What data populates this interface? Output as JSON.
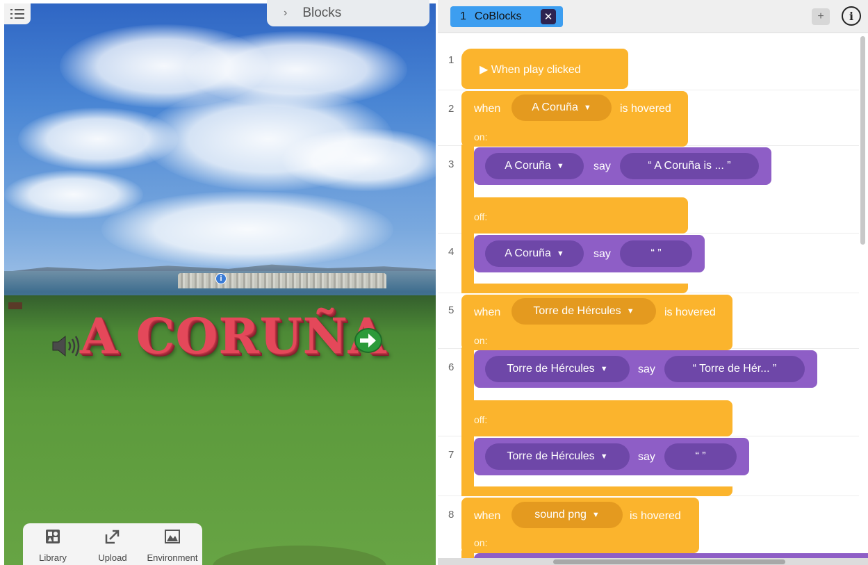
{
  "scene": {
    "blocks_tab_label": "Blocks",
    "title_3d": "A CORUÑA",
    "info_marker": "i",
    "toolbar": [
      {
        "label": "Library",
        "icon": "library-icon"
      },
      {
        "label": "Upload",
        "icon": "upload-icon"
      },
      {
        "label": "Environment",
        "icon": "environment-icon"
      }
    ]
  },
  "editor": {
    "tab": {
      "number": "1",
      "name": "CoBlocks",
      "close": "✕"
    },
    "add_label": "+",
    "info_label": "i",
    "line_numbers": [
      "1",
      "2",
      "3",
      "4",
      "5",
      "6",
      "7",
      "8"
    ],
    "blocks": {
      "play": "▶ When play clicked",
      "b2": {
        "when": "when",
        "object": "A Coruña",
        "event": "is hovered",
        "on": "on:",
        "off": "off:"
      },
      "b3": {
        "object": "A Coruña",
        "say": "say",
        "text": "“  A Coruña is ...  ”"
      },
      "b4": {
        "object": "A Coruña",
        "say": "say",
        "text": "“      ”"
      },
      "b5": {
        "when": "when",
        "object": "Torre de Hércules",
        "event": "is hovered",
        "on": "on:",
        "off": "off:"
      },
      "b6": {
        "object": "Torre de Hércules",
        "say": "say",
        "text": "“  Torre de Hér...  ”"
      },
      "b7": {
        "object": "Torre de Hércules",
        "say": "say",
        "text": "“      ”"
      },
      "b8": {
        "when": "when",
        "object": "sound png",
        "event": "is hovered",
        "on": "on:"
      }
    },
    "dropdown_glyph": "▼"
  },
  "colors": {
    "event_block": "#fbb42d",
    "action_block": "#8e5ec6",
    "tab_blue": "#3d9ef0",
    "title_red": "#e4485a"
  }
}
